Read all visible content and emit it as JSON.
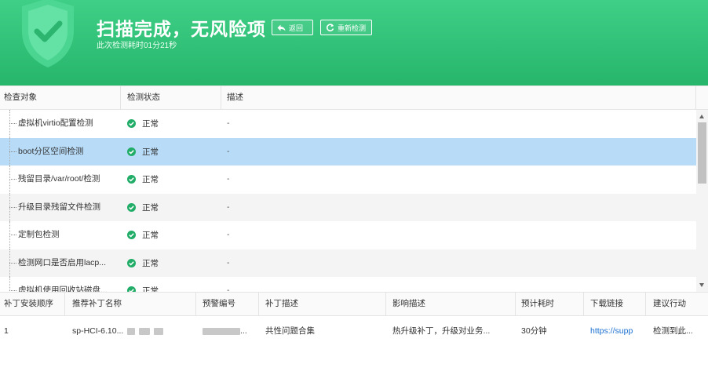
{
  "header": {
    "title": "扫描完成，无风险项",
    "subtitle": "此次检测耗时01分21秒",
    "back_label": "返回",
    "rescan_label": "重新检测",
    "icons": {
      "shield": "shield-check-icon",
      "back": "back-arrow-icon",
      "rescan": "refresh-icon"
    },
    "colors": {
      "bg_top": "#3fcf86",
      "bg_bottom": "#26b56b",
      "text": "#ffffff"
    }
  },
  "upper_table": {
    "columns": [
      "检查对象",
      "检测状态",
      "描述"
    ],
    "rows": [
      {
        "name": "虚拟机virtio配置检测",
        "status": "正常",
        "desc": "-"
      },
      {
        "name": "boot分区空间检测",
        "status": "正常",
        "desc": "-",
        "selected": true
      },
      {
        "name": "残留目录/var/root/检测",
        "status": "正常",
        "desc": "-"
      },
      {
        "name": "升级目录残留文件检测",
        "status": "正常",
        "desc": "-"
      },
      {
        "name": "定制包检测",
        "status": "正常",
        "desc": "-"
      },
      {
        "name": "检测网口是否启用lacp...",
        "status": "正常",
        "desc": "-"
      },
      {
        "name": "虚拟机使用回收站磁盘...",
        "status": "正常",
        "desc": "-"
      }
    ],
    "status_color": "#21ad68",
    "selected_color": "#b8dcf8"
  },
  "lower_table": {
    "columns": [
      "补丁安装顺序",
      "推荐补丁名称",
      "预警编号",
      "补丁描述",
      "影响描述",
      "预计耗时",
      "下载链接",
      "建议行动"
    ],
    "rows": [
      {
        "order": "1",
        "name": "sp-HCI-6.10...",
        "alert_no": "...",
        "patch_desc": "共性问题合集",
        "impact": "热升级补丁，升级对业务...",
        "duration": "30分钟",
        "link": "https://supp",
        "action": "检测到此..."
      }
    ],
    "link_color": "#1a6fd0"
  }
}
